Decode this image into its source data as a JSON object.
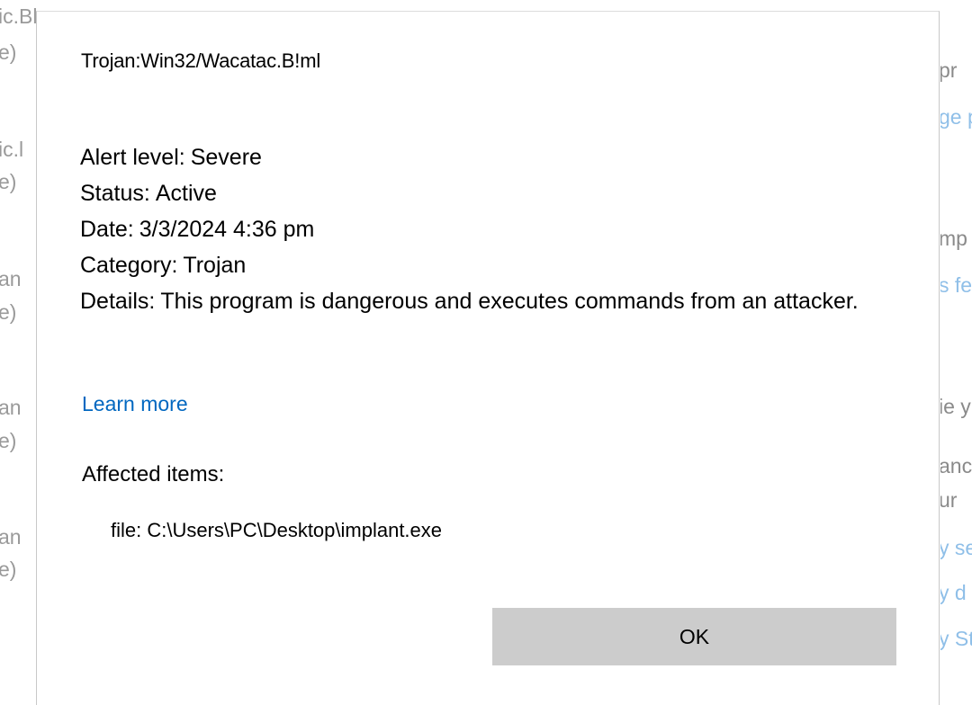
{
  "background_left": [
    "ic.Bl",
    "e)",
    "ic.l",
    "e)",
    "an",
    "e)",
    "an",
    "e)",
    "an",
    "e)"
  ],
  "background_right": [
    "pr",
    "ge p",
    "mp",
    "s fe",
    "ie y",
    "anc",
    "ur",
    "y se",
    "y d",
    "y St"
  ],
  "dialog": {
    "threat_name": "Trojan:Win32/Wacatac.B!ml",
    "alert_level": {
      "label": "Alert level:",
      "value": "Severe"
    },
    "status": {
      "label": "Status:",
      "value": "Active"
    },
    "date": {
      "label": "Date:",
      "value": "3/3/2024 4:36 pm"
    },
    "category": {
      "label": "Category:",
      "value": "Trojan"
    },
    "details": {
      "label": "Details:",
      "value": "This program is dangerous and executes commands from an attacker."
    },
    "learn_more": "Learn more",
    "affected_title": "Affected items:",
    "affected_item": "file: C:\\Users\\PC\\Desktop\\implant.exe",
    "ok_label": "OK"
  },
  "colors": {
    "link": "#0067c0",
    "button_bg": "#cccccc",
    "background_text": "#9a9a9a"
  }
}
